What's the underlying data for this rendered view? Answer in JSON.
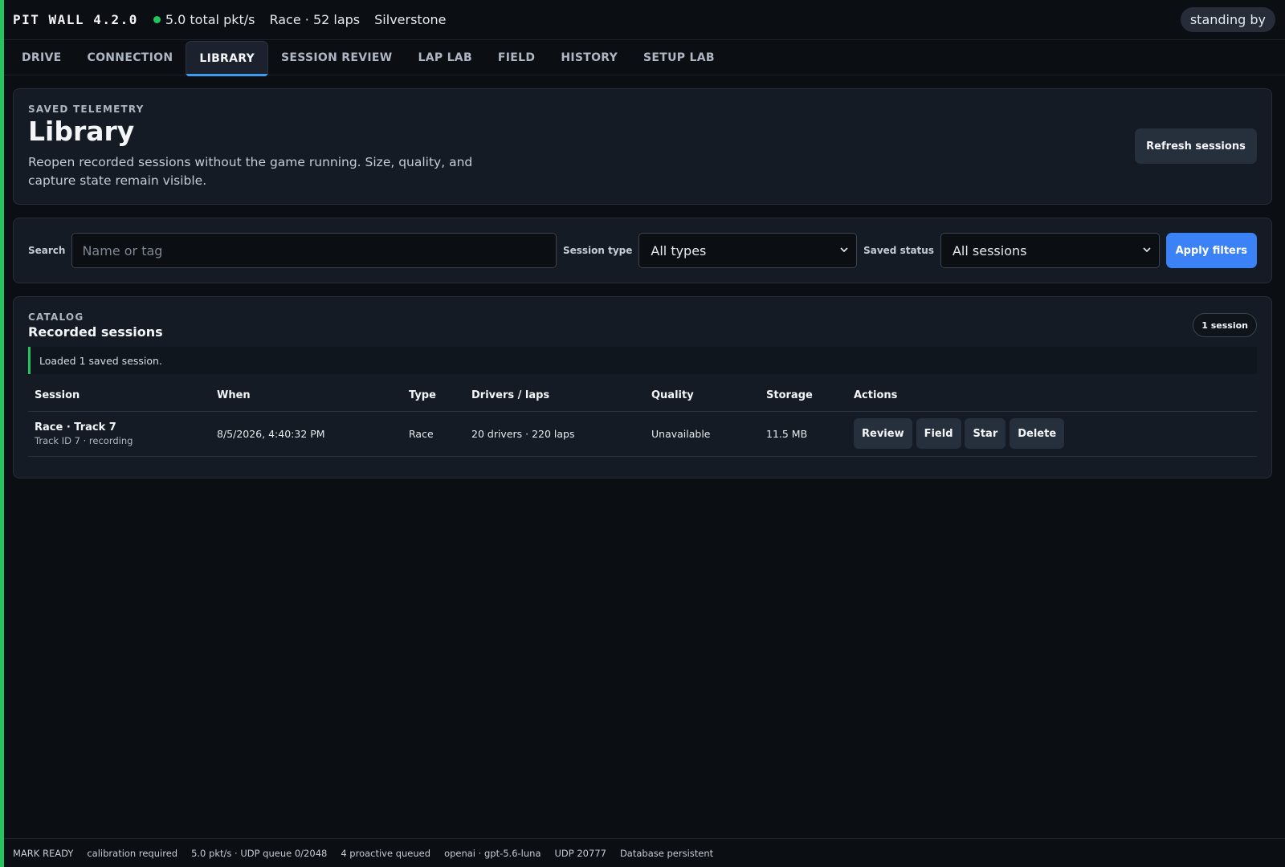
{
  "topbar": {
    "brand": "PIT WALL 4.2.0",
    "packet_rate": "5.0 total pkt/s",
    "session_info": "Race · 52 laps",
    "track": "Silverstone",
    "status_pill": "standing by",
    "status_color": "#22c55e"
  },
  "tabs": [
    {
      "label": "DRIVE"
    },
    {
      "label": "CONNECTION"
    },
    {
      "label": "LIBRARY",
      "active": true
    },
    {
      "label": "SESSION REVIEW"
    },
    {
      "label": "LAP LAB"
    },
    {
      "label": "FIELD"
    },
    {
      "label": "HISTORY"
    },
    {
      "label": "SETUP LAB"
    }
  ],
  "hero": {
    "eyebrow": "SAVED TELEMETRY",
    "title": "Library",
    "description": "Reopen recorded sessions without the game running. Size, quality, and capture state remain visible.",
    "refresh_label": "Refresh sessions"
  },
  "filters": {
    "search_label": "Search",
    "search_placeholder": "Name or tag",
    "search_value": "",
    "type_label": "Session type",
    "type_selected": "All types",
    "status_label": "Saved status",
    "status_selected": "All sessions",
    "apply_label": "Apply filters"
  },
  "catalog": {
    "eyebrow": "CATALOG",
    "title": "Recorded sessions",
    "count_badge": "1 session",
    "notice": "Loaded 1 saved session.",
    "columns": [
      "Session",
      "When",
      "Type",
      "Drivers / laps",
      "Quality",
      "Storage",
      "Actions"
    ],
    "rows": [
      {
        "name": "Race · Track 7",
        "meta": "Track ID 7 · recording",
        "when": "8/5/2026, 4:40:32 PM",
        "type": "Race",
        "drivers_laps": "20 drivers · 220 laps",
        "quality": "Unavailable",
        "storage": "11.5 MB",
        "actions": [
          "Review",
          "Field",
          "Star",
          "Delete"
        ]
      }
    ]
  },
  "footer": {
    "items": [
      "MARK READY",
      "calibration required",
      "5.0 pkt/s · UDP queue 0/2048",
      "4 proactive queued",
      "openai · gpt-5.6-luna",
      "UDP 20777",
      "Database persistent"
    ]
  },
  "colors": {
    "accent": "#3b82f6",
    "tab_underline": "#3b9cf0",
    "success": "#22c55e",
    "background": "#0b0e13",
    "panel": "#151b24"
  }
}
